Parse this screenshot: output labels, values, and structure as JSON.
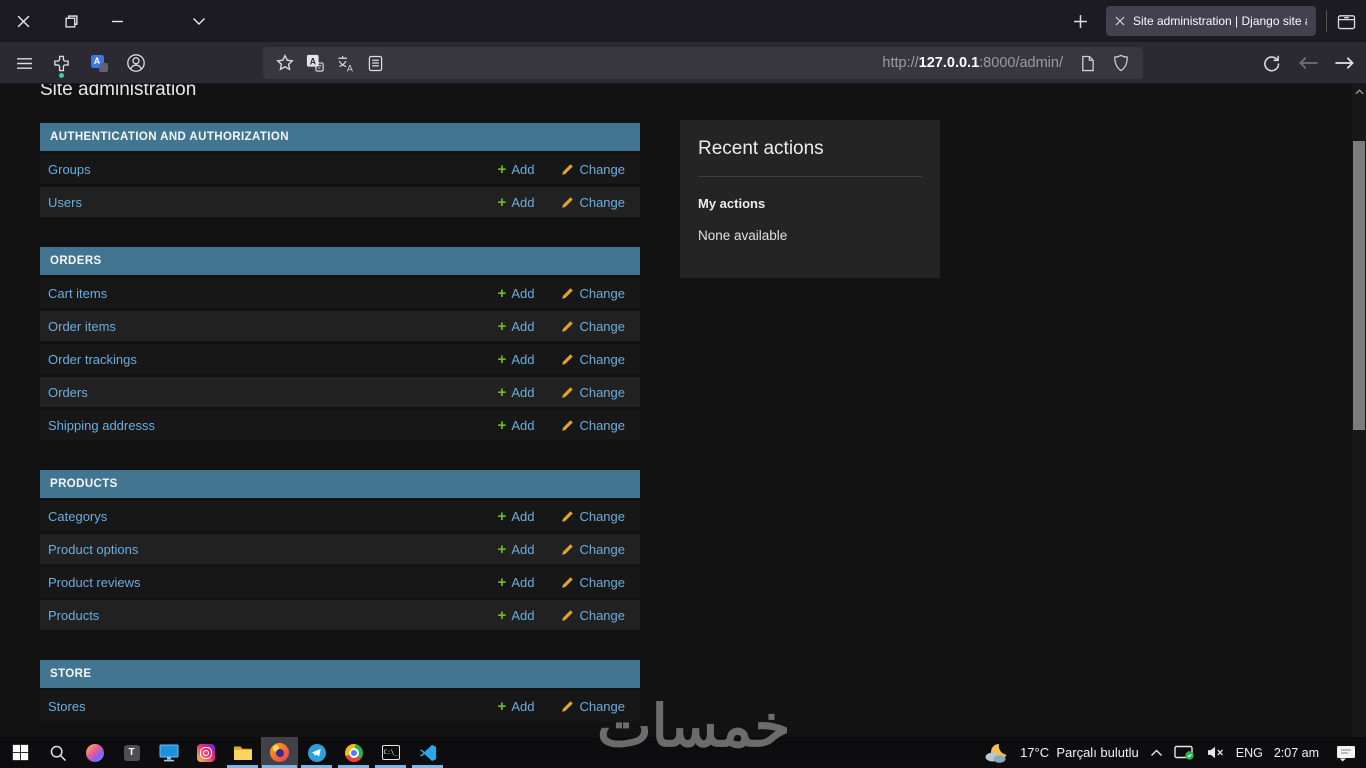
{
  "titlebar": {
    "tab_title": "Site administration | Django site ad"
  },
  "toolbar": {
    "url_protocol": "http://",
    "url_host": "127.0.0.1",
    "url_path": ":8000/admin/"
  },
  "page": {
    "heading": "Site administration",
    "add_label": "Add",
    "change_label": "Change",
    "sections": [
      {
        "title": "AUTHENTICATION AND AUTHORIZATION",
        "models": [
          "Groups",
          "Users"
        ]
      },
      {
        "title": "ORDERS",
        "models": [
          "Cart items",
          "Order items",
          "Order trackings",
          "Orders",
          "Shipping addresss"
        ]
      },
      {
        "title": "PRODUCTS",
        "models": [
          "Categorys",
          "Product options",
          "Product reviews",
          "Products"
        ]
      },
      {
        "title": "STORE",
        "models": [
          "Stores"
        ]
      }
    ],
    "recent_actions": {
      "title": "Recent actions",
      "my_actions": "My actions",
      "empty": "None available"
    }
  },
  "watermark": "خمسات",
  "taskbar": {
    "apps": [
      "windows-start",
      "search",
      "copilot",
      "t-app",
      "monitor",
      "instagram",
      "file-explorer",
      "firefox",
      "telegram",
      "chrome",
      "command-prompt",
      "vscode"
    ],
    "running": [
      "file-explorer",
      "firefox",
      "telegram",
      "chrome",
      "command-prompt",
      "vscode"
    ],
    "active": "firefox",
    "weather_temp": "17°C",
    "weather_condition": "Parçalı bulutlu",
    "language": "ENG",
    "time": "2:07 am"
  },
  "colors": {
    "section_header": "#427690",
    "link": "#6aaede",
    "add_green": "#6abe30",
    "change_amber": "#dfa32f",
    "taskbar_indicator": "#7ab8e8"
  }
}
